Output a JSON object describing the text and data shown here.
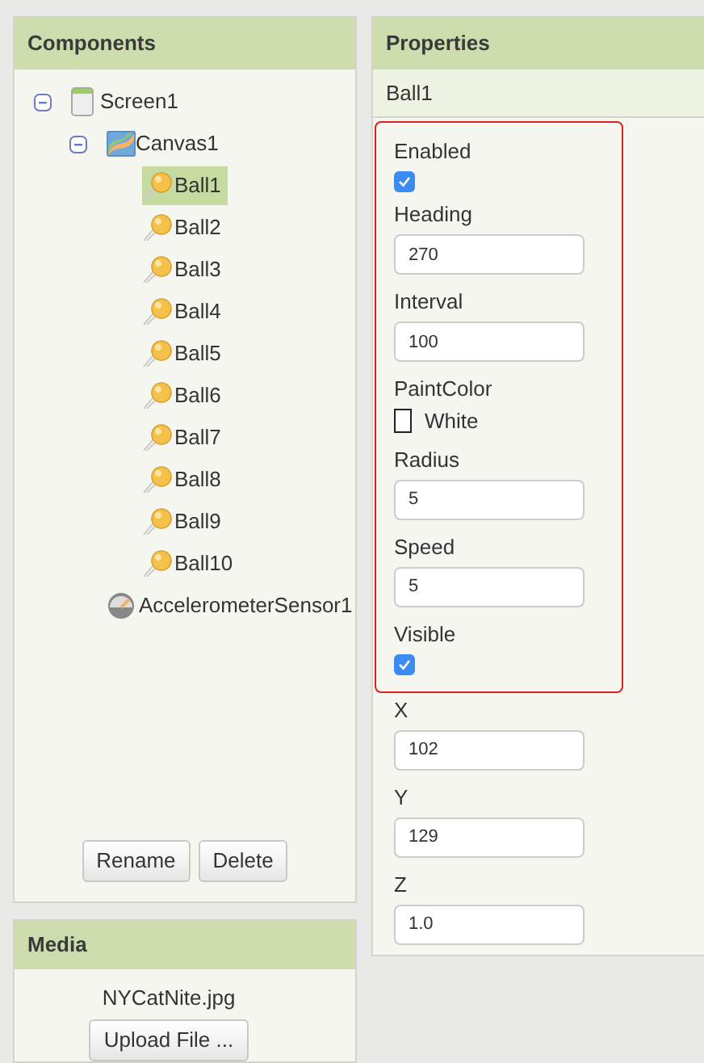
{
  "components": {
    "title": "Components",
    "tree": [
      {
        "label": "Screen1",
        "kind": "screen",
        "expanded": true,
        "selected": false,
        "children": [
          {
            "label": "Canvas1",
            "kind": "canvas",
            "expanded": true,
            "selected": false,
            "children": [
              {
                "label": "Ball1",
                "kind": "ball",
                "selected": true
              },
              {
                "label": "Ball2",
                "kind": "ball",
                "selected": false
              },
              {
                "label": "Ball3",
                "kind": "ball",
                "selected": false
              },
              {
                "label": "Ball4",
                "kind": "ball",
                "selected": false
              },
              {
                "label": "Ball5",
                "kind": "ball",
                "selected": false
              },
              {
                "label": "Ball6",
                "kind": "ball",
                "selected": false
              },
              {
                "label": "Ball7",
                "kind": "ball",
                "selected": false
              },
              {
                "label": "Ball8",
                "kind": "ball",
                "selected": false
              },
              {
                "label": "Ball9",
                "kind": "ball",
                "selected": false
              },
              {
                "label": "Ball10",
                "kind": "ball",
                "selected": false
              }
            ]
          },
          {
            "label": "AccelerometerSensor1",
            "kind": "sensor",
            "selected": false
          }
        ]
      }
    ],
    "buttons": [
      "Rename",
      "Delete"
    ]
  },
  "media": {
    "title": "Media",
    "files": [
      "NYCatNite.jpg"
    ],
    "upload_button": "Upload File ..."
  },
  "properties": {
    "title": "Properties",
    "component": "Ball1",
    "groups": [
      {
        "highlighted": true,
        "items": [
          {
            "label": "Enabled",
            "kind": "checkbox",
            "checked": true
          },
          {
            "label": "Heading",
            "kind": "text",
            "value": "270"
          },
          {
            "label": "Interval",
            "kind": "text",
            "value": "100"
          },
          {
            "label": "PaintColor",
            "kind": "color",
            "value": "White",
            "color": "#ffffff"
          },
          {
            "label": "Radius",
            "kind": "text",
            "value": "5"
          },
          {
            "label": "Speed",
            "kind": "text",
            "value": "5"
          },
          {
            "label": "Visible",
            "kind": "checkbox",
            "checked": true
          }
        ]
      },
      {
        "highlighted": false,
        "items": [
          {
            "label": "X",
            "kind": "text",
            "value": "102"
          },
          {
            "label": "Y",
            "kind": "text",
            "value": "129"
          },
          {
            "label": "Z",
            "kind": "text",
            "value": "1.0"
          }
        ]
      }
    ]
  }
}
